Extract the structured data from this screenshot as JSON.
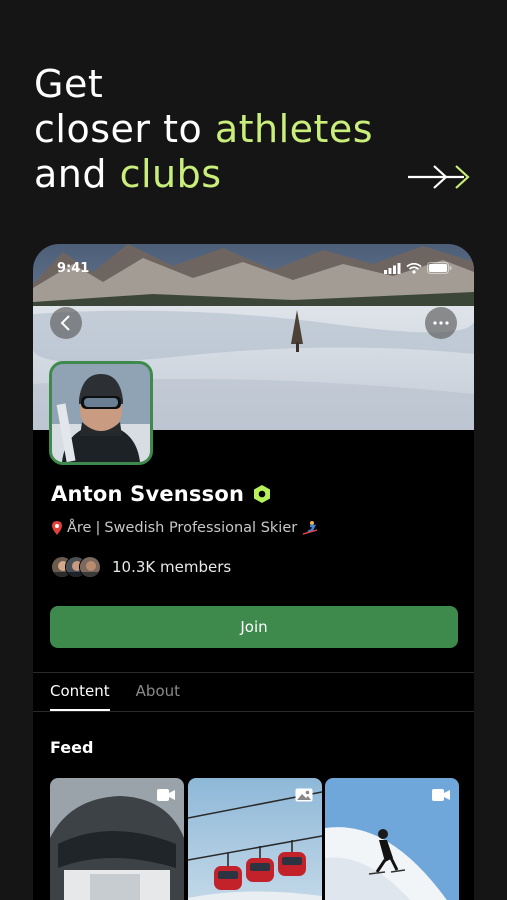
{
  "headline": {
    "line1": "Get",
    "line2_plain": "closer to ",
    "line2_highlight": "athletes",
    "line3_plain": "and ",
    "line3_highlight": "clubs"
  },
  "phone": {
    "status_time": "9:41"
  },
  "profile": {
    "name": "Anton Svensson",
    "location": "Åre",
    "separator": "|",
    "bio": "Swedish Professional Skier",
    "members": "10.3K members",
    "join_label": "Join"
  },
  "tabs": [
    {
      "label": "Content",
      "active": true
    },
    {
      "label": "About",
      "active": false
    }
  ],
  "feed": {
    "title": "Feed",
    "items": [
      {
        "media": "video",
        "icon": "video-camera-icon"
      },
      {
        "media": "image",
        "icon": "image-icon"
      },
      {
        "media": "video",
        "icon": "video-camera-icon"
      }
    ]
  },
  "colors": {
    "background": "#151515",
    "highlight": "#c9ef7a",
    "accent_green": "#3e8a4d",
    "verified": "#b8f05a"
  }
}
